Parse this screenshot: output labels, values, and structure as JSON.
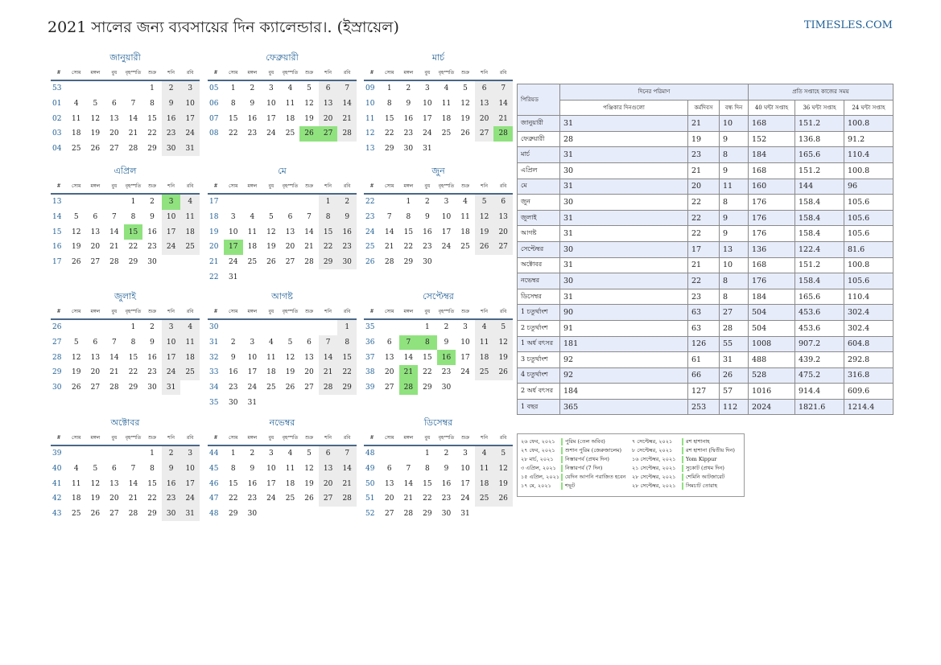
{
  "title": "2021 সালের জন্য ব্যবসায়ের দিন ক্যালেন্ডার।. (ইস্রায়েল)",
  "site": "TIMESLES.COM",
  "colors": {
    "accent": "#1f5f95",
    "holiday": "#90e27f",
    "weekend": "#ececec",
    "stripe": "#e7ecfa"
  },
  "weekday_headers": [
    "#",
    "সোম",
    "মঙ্গল",
    "বুধ",
    "বৃহস্পতি",
    "শুক্র",
    "শনি",
    "রবি"
  ],
  "months": [
    {
      "name": "জানুয়ারী",
      "weeks": [
        {
          "wk": "53",
          "days": [
            "",
            "",
            "",
            "",
            1,
            2,
            3
          ]
        },
        {
          "wk": "01",
          "days": [
            4,
            5,
            6,
            7,
            8,
            9,
            10
          ]
        },
        {
          "wk": "02",
          "days": [
            11,
            12,
            13,
            14,
            15,
            16,
            17
          ]
        },
        {
          "wk": "03",
          "days": [
            18,
            19,
            20,
            21,
            22,
            23,
            24
          ]
        },
        {
          "wk": "04",
          "days": [
            25,
            26,
            27,
            28,
            29,
            30,
            31
          ]
        }
      ],
      "holidays": []
    },
    {
      "name": "ফেব্রুয়ারী",
      "weeks": [
        {
          "wk": "05",
          "days": [
            1,
            2,
            3,
            4,
            5,
            6,
            7
          ]
        },
        {
          "wk": "06",
          "days": [
            8,
            9,
            10,
            11,
            12,
            13,
            14
          ]
        },
        {
          "wk": "07",
          "days": [
            15,
            16,
            17,
            18,
            19,
            20,
            21
          ]
        },
        {
          "wk": "08",
          "days": [
            22,
            23,
            24,
            25,
            26,
            27,
            28
          ]
        }
      ],
      "holidays": [
        26,
        27
      ]
    },
    {
      "name": "মার্চ",
      "weeks": [
        {
          "wk": "09",
          "days": [
            1,
            2,
            3,
            4,
            5,
            6,
            7
          ]
        },
        {
          "wk": "10",
          "days": [
            8,
            9,
            10,
            11,
            12,
            13,
            14
          ]
        },
        {
          "wk": "11",
          "days": [
            15,
            16,
            17,
            18,
            19,
            20,
            21
          ]
        },
        {
          "wk": "12",
          "days": [
            22,
            23,
            24,
            25,
            26,
            27,
            28
          ]
        },
        {
          "wk": "13",
          "days": [
            29,
            30,
            31,
            "",
            "",
            "",
            ""
          ]
        }
      ],
      "holidays": [
        28
      ]
    },
    {
      "name": "এপ্রিল",
      "weeks": [
        {
          "wk": "13",
          "days": [
            "",
            "",
            "",
            1,
            2,
            3,
            4
          ]
        },
        {
          "wk": "14",
          "days": [
            5,
            6,
            7,
            8,
            9,
            10,
            11
          ]
        },
        {
          "wk": "15",
          "days": [
            12,
            13,
            14,
            15,
            16,
            17,
            18
          ]
        },
        {
          "wk": "16",
          "days": [
            19,
            20,
            21,
            22,
            23,
            24,
            25
          ]
        },
        {
          "wk": "17",
          "days": [
            26,
            27,
            28,
            29,
            30,
            "",
            ""
          ]
        }
      ],
      "holidays": [
        3,
        15
      ]
    },
    {
      "name": "মে",
      "weeks": [
        {
          "wk": "17",
          "days": [
            "",
            "",
            "",
            "",
            "",
            1,
            2
          ]
        },
        {
          "wk": "18",
          "days": [
            3,
            4,
            5,
            6,
            7,
            8,
            9
          ]
        },
        {
          "wk": "19",
          "days": [
            10,
            11,
            12,
            13,
            14,
            15,
            16
          ]
        },
        {
          "wk": "20",
          "days": [
            17,
            18,
            19,
            20,
            21,
            22,
            23
          ]
        },
        {
          "wk": "21",
          "days": [
            24,
            25,
            26,
            27,
            28,
            29,
            30
          ]
        },
        {
          "wk": "22",
          "days": [
            31,
            "",
            "",
            "",
            "",
            "",
            ""
          ]
        }
      ],
      "holidays": [
        17
      ]
    },
    {
      "name": "জুন",
      "weeks": [
        {
          "wk": "22",
          "days": [
            "",
            1,
            2,
            3,
            4,
            5,
            6
          ]
        },
        {
          "wk": "23",
          "days": [
            7,
            8,
            9,
            10,
            11,
            12,
            13
          ]
        },
        {
          "wk": "24",
          "days": [
            14,
            15,
            16,
            17,
            18,
            19,
            20
          ]
        },
        {
          "wk": "25",
          "days": [
            21,
            22,
            23,
            24,
            25,
            26,
            27
          ]
        },
        {
          "wk": "26",
          "days": [
            28,
            29,
            30,
            "",
            "",
            "",
            ""
          ]
        }
      ],
      "holidays": []
    },
    {
      "name": "জুলাই",
      "weeks": [
        {
          "wk": "26",
          "days": [
            "",
            "",
            "",
            1,
            2,
            3,
            4
          ]
        },
        {
          "wk": "27",
          "days": [
            5,
            6,
            7,
            8,
            9,
            10,
            11
          ]
        },
        {
          "wk": "28",
          "days": [
            12,
            13,
            14,
            15,
            16,
            17,
            18
          ]
        },
        {
          "wk": "29",
          "days": [
            19,
            20,
            21,
            22,
            23,
            24,
            25
          ]
        },
        {
          "wk": "30",
          "days": [
            26,
            27,
            28,
            29,
            30,
            31,
            ""
          ]
        }
      ],
      "holidays": []
    },
    {
      "name": "আগষ্ট",
      "weeks": [
        {
          "wk": "30",
          "days": [
            "",
            "",
            "",
            "",
            "",
            "",
            1
          ]
        },
        {
          "wk": "31",
          "days": [
            2,
            3,
            4,
            5,
            6,
            7,
            8
          ]
        },
        {
          "wk": "32",
          "days": [
            9,
            10,
            11,
            12,
            13,
            14,
            15
          ]
        },
        {
          "wk": "33",
          "days": [
            16,
            17,
            18,
            19,
            20,
            21,
            22
          ]
        },
        {
          "wk": "34",
          "days": [
            23,
            24,
            25,
            26,
            27,
            28,
            29
          ]
        },
        {
          "wk": "35",
          "days": [
            30,
            31,
            "",
            "",
            "",
            "",
            ""
          ]
        }
      ],
      "holidays": []
    },
    {
      "name": "সেপ্টেম্বর",
      "weeks": [
        {
          "wk": "35",
          "days": [
            "",
            "",
            1,
            2,
            3,
            4,
            5
          ]
        },
        {
          "wk": "36",
          "days": [
            6,
            7,
            8,
            9,
            10,
            11,
            12
          ]
        },
        {
          "wk": "37",
          "days": [
            13,
            14,
            15,
            16,
            17,
            18,
            19
          ]
        },
        {
          "wk": "38",
          "days": [
            20,
            21,
            22,
            23,
            24,
            25,
            26
          ]
        },
        {
          "wk": "39",
          "days": [
            27,
            28,
            29,
            30,
            "",
            "",
            ""
          ]
        }
      ],
      "holidays": [
        7,
        8,
        16,
        21,
        28
      ]
    },
    {
      "name": "অক্টোবর",
      "weeks": [
        {
          "wk": "39",
          "days": [
            "",
            "",
            "",
            "",
            1,
            2,
            3
          ]
        },
        {
          "wk": "40",
          "days": [
            4,
            5,
            6,
            7,
            8,
            9,
            10
          ]
        },
        {
          "wk": "41",
          "days": [
            11,
            12,
            13,
            14,
            15,
            16,
            17
          ]
        },
        {
          "wk": "42",
          "days": [
            18,
            19,
            20,
            21,
            22,
            23,
            24
          ]
        },
        {
          "wk": "43",
          "days": [
            25,
            26,
            27,
            28,
            29,
            30,
            31
          ]
        }
      ],
      "holidays": []
    },
    {
      "name": "নভেম্বর",
      "weeks": [
        {
          "wk": "44",
          "days": [
            1,
            2,
            3,
            4,
            5,
            6,
            7
          ]
        },
        {
          "wk": "45",
          "days": [
            8,
            9,
            10,
            11,
            12,
            13,
            14
          ]
        },
        {
          "wk": "46",
          "days": [
            15,
            16,
            17,
            18,
            19,
            20,
            21
          ]
        },
        {
          "wk": "47",
          "days": [
            22,
            23,
            24,
            25,
            26,
            27,
            28
          ]
        },
        {
          "wk": "48",
          "days": [
            29,
            30,
            "",
            "",
            "",
            "",
            ""
          ]
        }
      ],
      "holidays": []
    },
    {
      "name": "ডিসেম্বর",
      "weeks": [
        {
          "wk": "48",
          "days": [
            "",
            "",
            1,
            2,
            3,
            4,
            5
          ]
        },
        {
          "wk": "49",
          "days": [
            6,
            7,
            8,
            9,
            10,
            11,
            12
          ]
        },
        {
          "wk": "50",
          "days": [
            13,
            14,
            15,
            16,
            17,
            18,
            19
          ]
        },
        {
          "wk": "51",
          "days": [
            20,
            21,
            22,
            23,
            24,
            25,
            26
          ]
        },
        {
          "wk": "52",
          "days": [
            27,
            28,
            29,
            30,
            31,
            "",
            ""
          ]
        }
      ],
      "holidays": []
    }
  ],
  "stats": {
    "header_period": "পিরিয়ড",
    "header_days": "দিনের পরিমাণ",
    "header_hours": "প্রতি সপ্তাহে কাজের সময়",
    "sub_headers": [
      "পঞ্জিকার দিনগুলো",
      "কর্মদিবস",
      "বন্ধ দিন",
      "40 ঘন্টা সপ্তাহ",
      "36 ঘন্টা সপ্তাহ",
      "24 ঘন্টা সপ্তাহ"
    ],
    "rows": [
      [
        "জানুয়ারী",
        "31",
        "21",
        "10",
        "168",
        "151.2",
        "100.8"
      ],
      [
        "ফেব্রুয়ারী",
        "28",
        "19",
        "9",
        "152",
        "136.8",
        "91.2"
      ],
      [
        "মার্চ",
        "31",
        "23",
        "8",
        "184",
        "165.6",
        "110.4"
      ],
      [
        "এপ্রিল",
        "30",
        "21",
        "9",
        "168",
        "151.2",
        "100.8"
      ],
      [
        "মে",
        "31",
        "20",
        "11",
        "160",
        "144",
        "96"
      ],
      [
        "জুন",
        "30",
        "22",
        "8",
        "176",
        "158.4",
        "105.6"
      ],
      [
        "জুলাই",
        "31",
        "22",
        "9",
        "176",
        "158.4",
        "105.6"
      ],
      [
        "আগষ্ট",
        "31",
        "22",
        "9",
        "176",
        "158.4",
        "105.6"
      ],
      [
        "সেপ্টেম্বর",
        "30",
        "17",
        "13",
        "136",
        "122.4",
        "81.6"
      ],
      [
        "অক্টোবর",
        "31",
        "21",
        "10",
        "168",
        "151.2",
        "100.8"
      ],
      [
        "নভেম্বর",
        "30",
        "22",
        "8",
        "176",
        "158.4",
        "105.6"
      ],
      [
        "ডিসেম্বর",
        "31",
        "23",
        "8",
        "184",
        "165.6",
        "110.4"
      ],
      [
        "1 চতুর্থাংশ",
        "90",
        "63",
        "27",
        "504",
        "453.6",
        "302.4"
      ],
      [
        "2 চতুর্থাংশ",
        "91",
        "63",
        "28",
        "504",
        "453.6",
        "302.4"
      ],
      [
        "1 অর্ধ বৎসর",
        "181",
        "126",
        "55",
        "1008",
        "907.2",
        "604.8"
      ],
      [
        "3 চতুর্থাংশ",
        "92",
        "61",
        "31",
        "488",
        "439.2",
        "292.8"
      ],
      [
        "4 চতুর্থাংশ",
        "92",
        "66",
        "26",
        "528",
        "475.2",
        "316.8"
      ],
      [
        "2 অর্ধ বৎসর",
        "184",
        "127",
        "57",
        "1016",
        "914.4",
        "609.6"
      ],
      [
        "1 বছর",
        "365",
        "253",
        "112",
        "2024",
        "1821.6",
        "1214.4"
      ]
    ]
  },
  "legend": [
    {
      "date": "২৬ ফেব, ২০২১",
      "name": "পুরিম (তেল অবিব)"
    },
    {
      "date": "২৭ ফেব, ২০২১",
      "name": "শুশান পুরিম (জেরুজালেম)"
    },
    {
      "date": "২৮ মার্চ, ২০২১",
      "name": "নিস্তারপর্ব (প্রথম দিন)"
    },
    {
      "date": "৩ এপ্রিল, ২০২১",
      "name": "নিস্তারপর্ব (7 দিন)"
    },
    {
      "date": "১৫ এপ্রিল, ২০২১",
      "name": "যেদিন আপনি পরাজিত হবেন"
    },
    {
      "date": "১৭ মে, ২০২১",
      "name": "শভূট"
    },
    {
      "date": "৭ সেপ্টেম্বর, ২০২১",
      "name": "রশ হাশানাহ"
    },
    {
      "date": "৮ সেপ্টেম্বর, ২০২১",
      "name": "রশ হাশানা (দ্বিতীয় দিন)"
    },
    {
      "date": "১৬ সেপ্টেম্বর, ২০২১",
      "name": "Yom Kippur"
    },
    {
      "date": "২১ সেপ্টেম্বর, ২০২১",
      "name": "সুকোট (প্রথম দিন)"
    },
    {
      "date": "২৮ সেপ্টেম্বর, ২০২১",
      "name": "শেমিনি আটজারেট"
    },
    {
      "date": "২৮ সেপ্টেম্বর, ২০২১",
      "name": "সিমচাট তোরাহ"
    }
  ]
}
